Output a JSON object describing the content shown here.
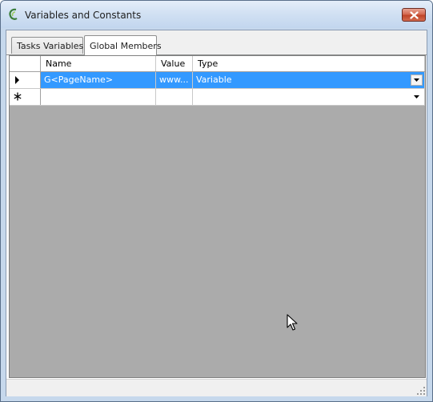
{
  "window": {
    "title": "Variables and Constants",
    "app_icon": "app-logo-icon",
    "close_icon": "close-icon"
  },
  "tabs": [
    {
      "label": "Tasks Variables",
      "active": false
    },
    {
      "label": "Global Members",
      "active": true
    }
  ],
  "grid": {
    "columns": [
      "Name",
      "Value",
      "Type"
    ],
    "rows": [
      {
        "marker": "current-row-arrow-icon",
        "name": "G<PageName>",
        "value": "www...",
        "type": "Variable",
        "selected": true
      }
    ],
    "new_row": {
      "marker": "new-row-asterisk-icon",
      "name": "",
      "value": "",
      "type": ""
    },
    "empty_area_color": "#ababab"
  },
  "colors": {
    "selection": "#3399ff",
    "close_button": "#c04528",
    "title_bar": "#d2e1f3"
  }
}
